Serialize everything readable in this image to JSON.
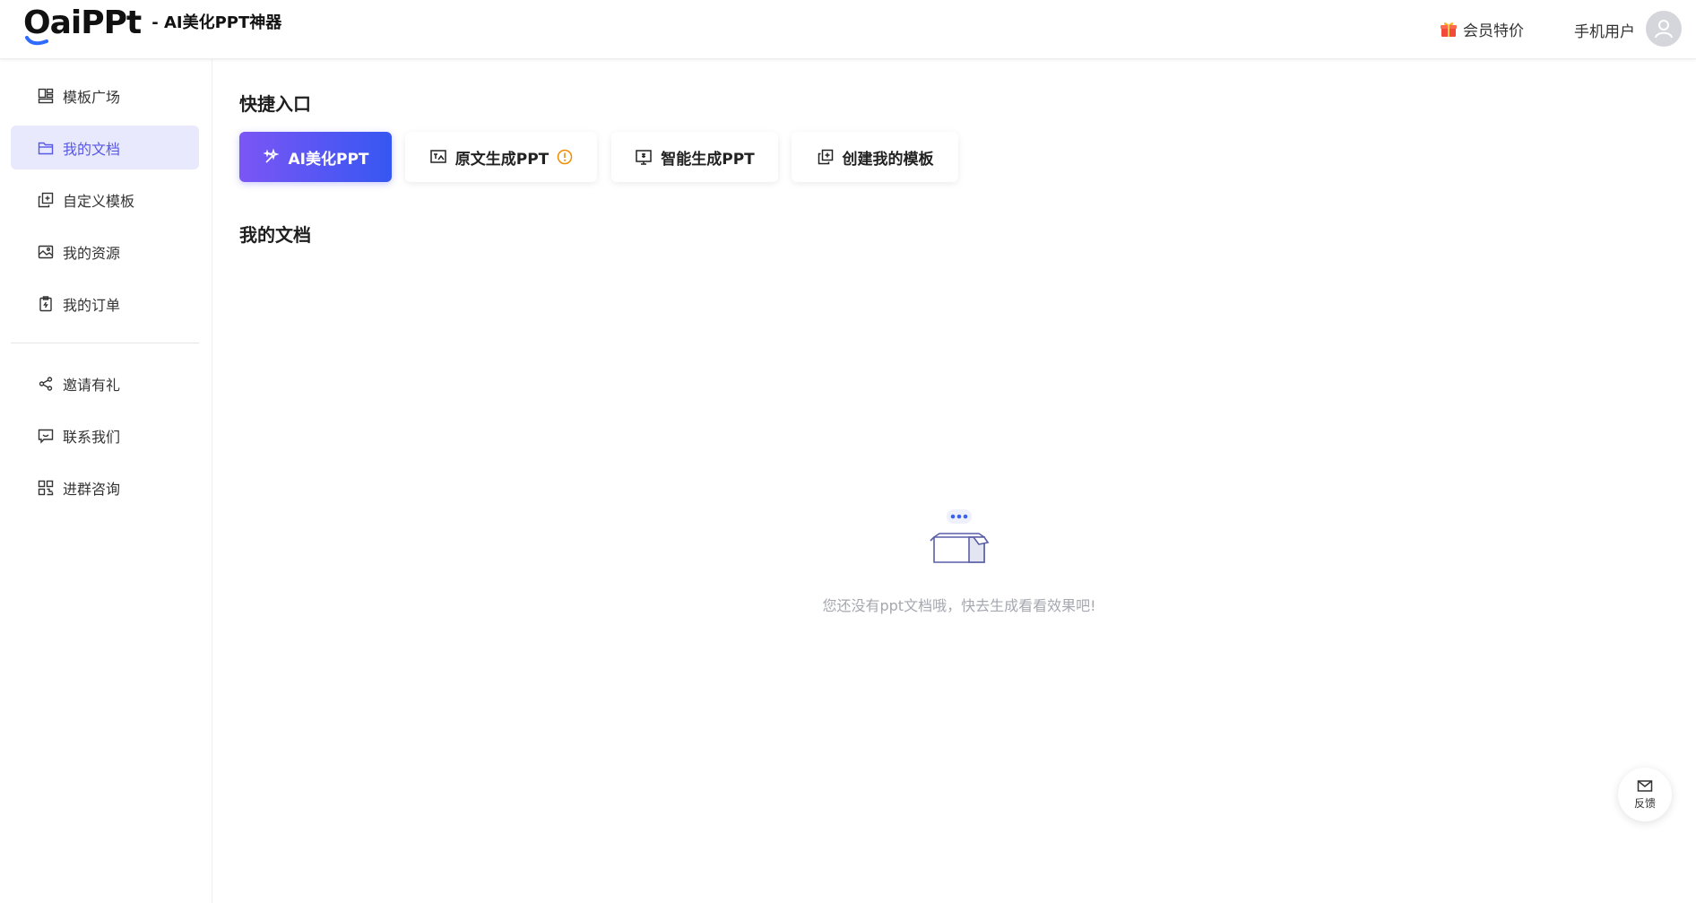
{
  "header": {
    "logo_text": "OaiPPt",
    "subtitle": "- AI美化PPT神器",
    "vip_label": "会员特价",
    "user_name": "手机用户"
  },
  "sidebar": {
    "items": [
      {
        "label": "模板广场",
        "icon": "template-grid-icon"
      },
      {
        "label": "我的文档",
        "icon": "folder-icon",
        "active": true
      },
      {
        "label": "自定义模板",
        "icon": "copy-plus-icon"
      },
      {
        "label": "我的资源",
        "icon": "image-icon"
      },
      {
        "label": "我的订单",
        "icon": "clipboard-icon"
      },
      {
        "label": "邀请有礼",
        "icon": "share-icon"
      },
      {
        "label": "联系我们",
        "icon": "message-smile-icon"
      },
      {
        "label": "进群咨询",
        "icon": "qrcode-icon"
      }
    ]
  },
  "main": {
    "quick_title": "快捷入口",
    "quick_buttons": [
      {
        "label": "AI美化PPT",
        "icon": "magic-wand-icon"
      },
      {
        "label": "原文生成PPT",
        "icon": "text-image-icon"
      },
      {
        "label": "智能生成PPT",
        "icon": "presentation-icon"
      },
      {
        "label": "创建我的模板",
        "icon": "copy-plus-icon"
      }
    ],
    "docs_title": "我的文档",
    "empty_text": "您还没有ppt文档哦，快去生成看看效果吧!"
  },
  "feedback_label": "反馈",
  "colors": {
    "accent": "#5757e8",
    "active_bg": "#e8e9fc",
    "gradient_start": "#7b56f5",
    "gradient_end": "#3657f2",
    "warning": "#f08c00"
  }
}
